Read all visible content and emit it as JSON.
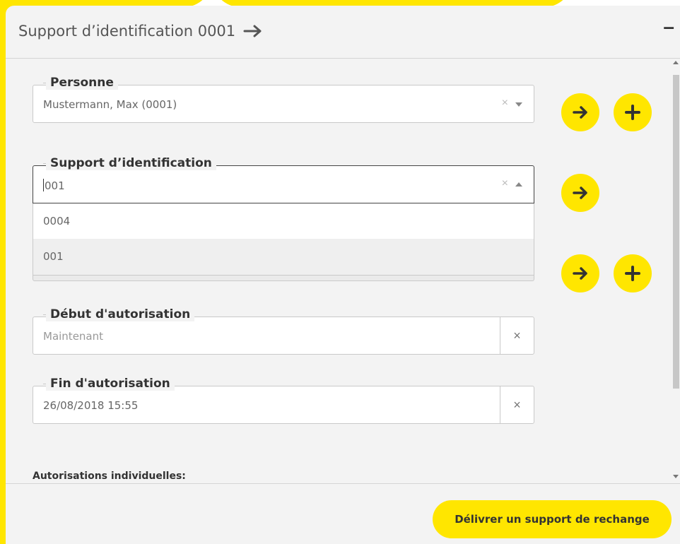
{
  "panel": {
    "title": "Support d’identification 0001",
    "collapse_label": "–"
  },
  "fields": {
    "person": {
      "label": "Personne",
      "value": "Mustermann, Max (0001)"
    },
    "medium": {
      "label": "Support d’identification",
      "value": "001"
    },
    "start": {
      "label": "Début d'autorisation",
      "value": "Maintenant"
    },
    "end": {
      "label": "Fin d'autorisation",
      "value": "26/08/2018 15:55"
    }
  },
  "dropdown": {
    "options": [
      "0004",
      "001"
    ],
    "highlighted": "001"
  },
  "section": {
    "individual_auth_label": "Autorisations individuelles:"
  },
  "footer": {
    "primary_button": "Délivrer un support de rechange"
  },
  "icons": {
    "clear": "×"
  },
  "colors": {
    "accent": "#ffe600",
    "panel_bg": "#f3f3f3"
  }
}
